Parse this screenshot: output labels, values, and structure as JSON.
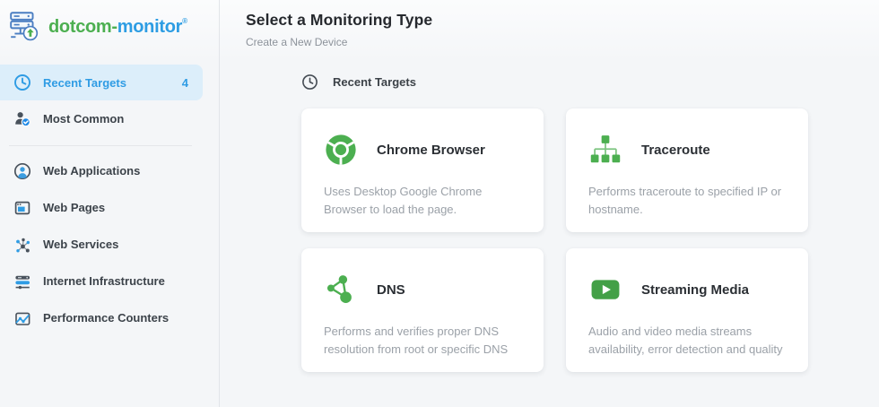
{
  "logo": {
    "brand_green": "dotcom-",
    "brand_blue": "monitor",
    "registered": "®"
  },
  "header": {
    "title": "Select a Monitoring Type",
    "subtitle": "Create a New Device"
  },
  "section": {
    "label": "Recent Targets",
    "icon": "clock-icon"
  },
  "sidebar": {
    "items": [
      {
        "label": "Recent Targets",
        "count": "4",
        "icon": "clock-icon",
        "active": true
      },
      {
        "label": "Most Common",
        "icon": "user-check-icon",
        "active": false
      },
      {
        "label": "Web Applications",
        "icon": "user-circle-icon",
        "active": false
      },
      {
        "label": "Web Pages",
        "icon": "browser-window-icon",
        "active": false
      },
      {
        "label": "Web Services",
        "icon": "network-nodes-icon",
        "active": false
      },
      {
        "label": "Internet Infrastructure",
        "icon": "server-bars-icon",
        "active": false
      },
      {
        "label": "Performance Counters",
        "icon": "line-chart-icon",
        "active": false
      }
    ]
  },
  "cards": [
    {
      "title": "Chrome Browser",
      "icon": "chrome-icon",
      "description": "Uses Desktop Google Chrome Browser to load the page."
    },
    {
      "title": "Traceroute",
      "icon": "traceroute-icon",
      "description": "Performs traceroute to specified IP or hostname."
    },
    {
      "title": "DNS",
      "icon": "dns-nodes-icon",
      "description": "Performs and verifies proper DNS resolution from root or specific DNS"
    },
    {
      "title": "Streaming Media",
      "icon": "play-media-icon",
      "description": "Audio and video media streams availability, error detection and quality"
    }
  ],
  "colors": {
    "accent_blue": "#2f9ce4",
    "accent_green": "#4caf50",
    "active_item_bg": "#dceefa",
    "page_bg": "#f4f6f8",
    "card_bg": "#ffffff",
    "text_dark": "#2b2f34",
    "text_muted": "#9ba1a8"
  }
}
